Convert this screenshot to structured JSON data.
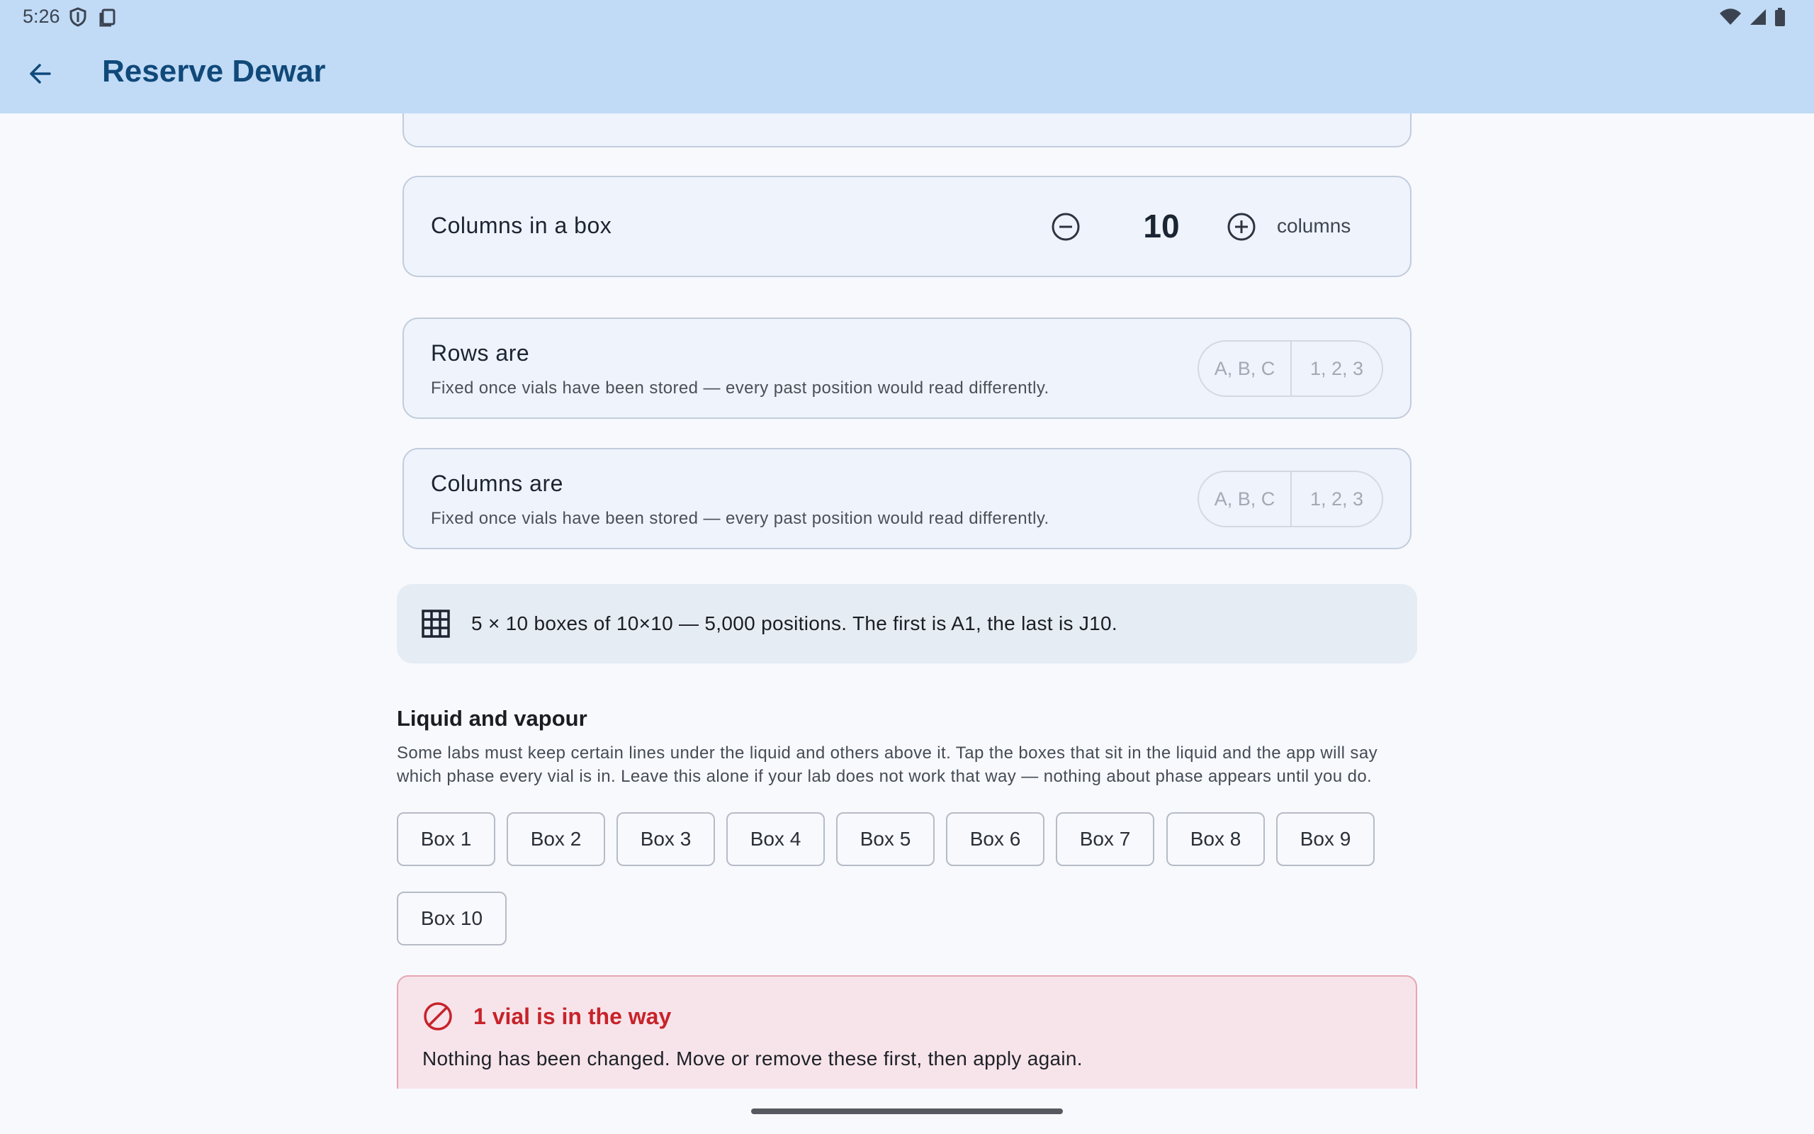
{
  "status_bar": {
    "time": "5:26",
    "icons_left": [
      "shield-icon",
      "clipboard-icon"
    ],
    "icons_right": [
      "wifi-icon",
      "signal-icon",
      "battery-icon"
    ]
  },
  "app_bar": {
    "back_icon": "arrow-back-icon",
    "title": "Reserve Dewar"
  },
  "columns_card": {
    "label": "Columns in a box",
    "value": "10",
    "unit": "columns",
    "minus_icon": "minus-circle-icon",
    "plus_icon": "plus-circle-icon"
  },
  "rows_are": {
    "label": "Rows are",
    "help": "Fixed once vials have been stored — every past position would read differently.",
    "options": [
      "A, B, C",
      "1, 2, 3"
    ]
  },
  "columns_are": {
    "label": "Columns are",
    "help": "Fixed once vials have been stored — every past position would read differently.",
    "options": [
      "A, B, C",
      "1, 2, 3"
    ]
  },
  "summary": {
    "icon": "grid-icon",
    "text": "5 × 10 boxes of 10×10 — 5,000 positions. The first is A1, the last is J10."
  },
  "liquid_section": {
    "title": "Liquid and vapour",
    "description_line1": "Some labs must keep certain lines under the liquid and others above it. Tap the boxes that sit in the liquid and the app will say",
    "description_line2": "which phase every vial is in. Leave this alone if your lab does not work that way — nothing about phase appears until you do.",
    "boxes": [
      "Box 1",
      "Box 2",
      "Box 3",
      "Box 4",
      "Box 5",
      "Box 6",
      "Box 7",
      "Box 8",
      "Box 9",
      "Box 10"
    ]
  },
  "error": {
    "icon": "block-icon",
    "title": "1 vial is in the way",
    "text": "Nothing has been changed. Move or remove these first, then apply again.",
    "color": "#c7232a"
  },
  "colors": {
    "app_bar": "#c1dbf6",
    "title": "#10497a",
    "card_bg": "#eef3fc",
    "error_bg": "#f7e4ea"
  }
}
